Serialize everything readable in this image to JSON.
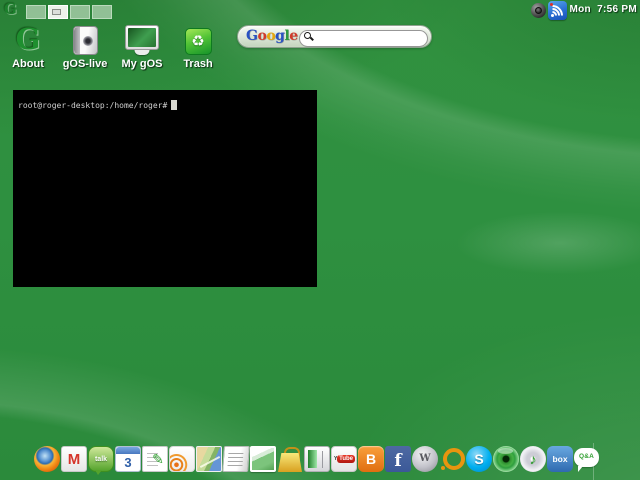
{
  "colors": {
    "wallpaper_green": "#2e9040",
    "label_text": "#ffffff",
    "terminal_bg": "#000000",
    "terminal_fg": "#cfcfcf",
    "wifi_blue": "#2a6fd4",
    "trash_green": "#52c436"
  },
  "topbar": {
    "logo_glyph": "G",
    "workspaces": [
      "1",
      "2",
      "3",
      "4"
    ],
    "active_workspace": 2,
    "clock": "Mon  7:56 PM"
  },
  "desktop_icons": [
    {
      "id": "about",
      "label": "About",
      "glyph": "G"
    },
    {
      "id": "gos-live",
      "label": "gOS-live",
      "glyph": ""
    },
    {
      "id": "my-gos",
      "label": "My gOS",
      "glyph": ""
    },
    {
      "id": "trash",
      "label": "Trash",
      "glyph": "♻"
    }
  ],
  "search_widget": {
    "logo_letters": [
      {
        "ch": "G",
        "color": "#2a52c2"
      },
      {
        "ch": "o",
        "color": "#d23b2a"
      },
      {
        "ch": "o",
        "color": "#e8a70c"
      },
      {
        "ch": "g",
        "color": "#2a52c2"
      },
      {
        "ch": "l",
        "color": "#2f9a3f"
      },
      {
        "ch": "e",
        "color": "#d23b2a"
      }
    ],
    "input_value": ""
  },
  "terminal": {
    "prompt": "root@roger-desktop:/home/roger#"
  },
  "dock": {
    "items": [
      {
        "id": "firefox",
        "name": "Firefox"
      },
      {
        "id": "gmail",
        "name": "Gmail",
        "glyph": "M"
      },
      {
        "id": "google-talk",
        "name": "Google Talk",
        "glyph": "talk"
      },
      {
        "id": "google-calendar",
        "name": "Google Calendar",
        "glyph": "3"
      },
      {
        "id": "google-docs",
        "name": "Google Docs",
        "glyph": "✎"
      },
      {
        "id": "google-reader",
        "name": "Google Reader"
      },
      {
        "id": "google-maps",
        "name": "Google Maps"
      },
      {
        "id": "google-news",
        "name": "Google News"
      },
      {
        "id": "google-photos",
        "name": "Photos"
      },
      {
        "id": "google-shopping",
        "name": "Google Product Search"
      },
      {
        "id": "gos-apps",
        "name": "gOS Applications"
      },
      {
        "id": "youtube",
        "name": "YouTube",
        "glyph": "You",
        "glyph2": "Tube"
      },
      {
        "id": "blogger",
        "name": "Blogger",
        "glyph": "B"
      },
      {
        "id": "facebook",
        "name": "Facebook",
        "glyph": "f"
      },
      {
        "id": "wikipedia",
        "name": "Wikipedia",
        "glyph": "W"
      },
      {
        "id": "meebo",
        "name": "Meebo"
      },
      {
        "id": "skype",
        "name": "Skype",
        "glyph": "S"
      },
      {
        "id": "xine",
        "name": "Xine Movie Player"
      },
      {
        "id": "music-player",
        "name": "Music Player",
        "glyph": "♪"
      },
      {
        "id": "box",
        "name": "Box.net",
        "glyph": "box"
      },
      {
        "id": "faqly",
        "name": "Faqly",
        "glyph": "Q&A"
      }
    ]
  }
}
